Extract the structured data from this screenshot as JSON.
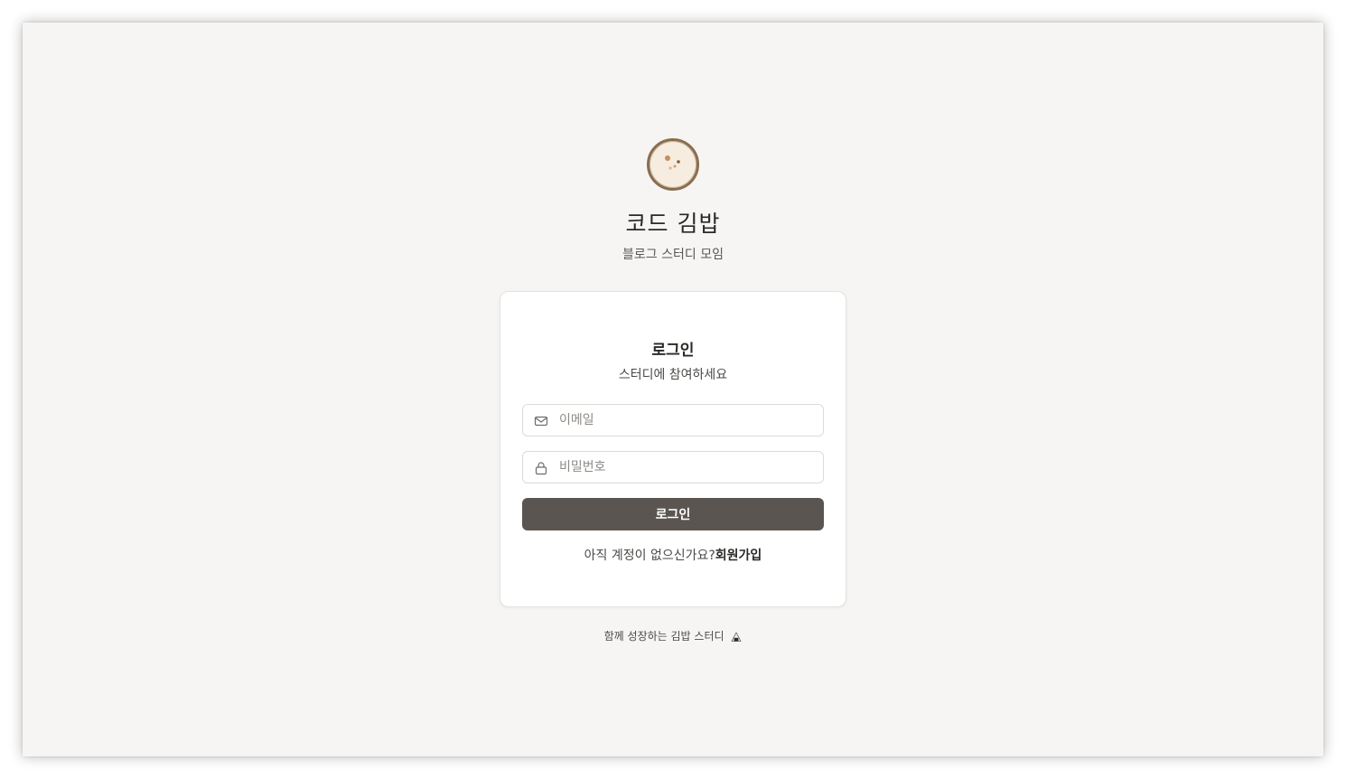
{
  "brand": {
    "title": "코드 김밥",
    "subtitle": "블로그 스터디 모임",
    "logo_icon": "kimbap-logo-icon"
  },
  "login_card": {
    "title": "로그인",
    "subtitle": "스터디에 참여하세요",
    "email": {
      "placeholder": "이메일",
      "value": "",
      "icon": "mail-icon"
    },
    "password": {
      "placeholder": "비밀번호",
      "value": "",
      "icon": "lock-icon"
    },
    "submit_label": "로그인",
    "signup_prompt": "아직 계정이 없으신가요?",
    "signup_link": "회원가입"
  },
  "footer": {
    "text": "함께 성장하는 김밥 스터디",
    "icon": "kimbap-icon"
  },
  "colors": {
    "background": "#f6f5f3",
    "card": "#ffffff",
    "button": "#5a5550",
    "logo_ring": "#8a6d4f"
  }
}
